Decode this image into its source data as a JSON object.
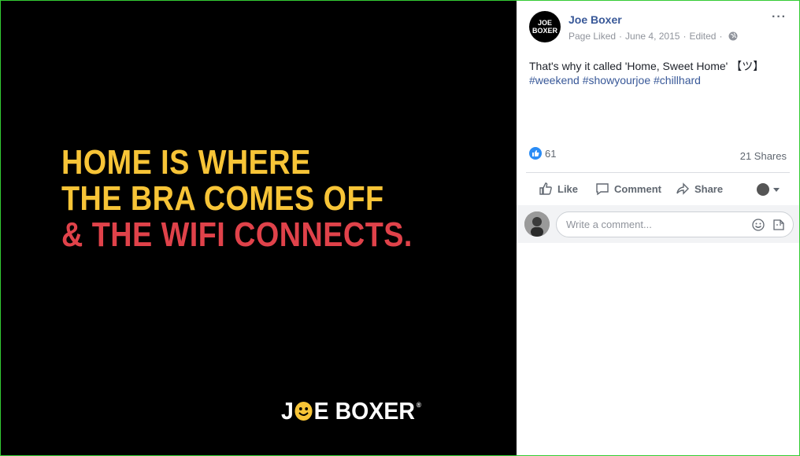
{
  "image": {
    "headline_line1": "HOME IS WHERE",
    "headline_line2": "THE BRA COMES OFF",
    "headline_line3": "& THE WIFI CONNECTS.",
    "brand_part1": "J",
    "brand_part2": "E BOXER",
    "brand_trademark": "®",
    "colors": {
      "background": "#000000",
      "yellow": "#f7c437",
      "red": "#e0424a"
    }
  },
  "post": {
    "avatar_text_line1": "JOE",
    "avatar_text_line2": "BOXER",
    "page_name": "Joe Boxer",
    "status": "Page Liked",
    "separator": "·",
    "date": "June 4, 2015",
    "edited": "Edited",
    "more_icon": "···",
    "text": "That's why it called 'Home, Sweet Home' 【ツ】",
    "hashtags": [
      "#weekend",
      "#showyourjoe",
      "#chillhard"
    ]
  },
  "reactions": {
    "like_count": "61",
    "shares": "21 Shares"
  },
  "actions": {
    "like_label": "Like",
    "comment_label": "Comment",
    "share_label": "Share"
  },
  "comment_box": {
    "placeholder": "Write a comment..."
  },
  "colors": {
    "link": "#385898",
    "muted": "#90949c",
    "like_blue": "#2a8cf5"
  }
}
